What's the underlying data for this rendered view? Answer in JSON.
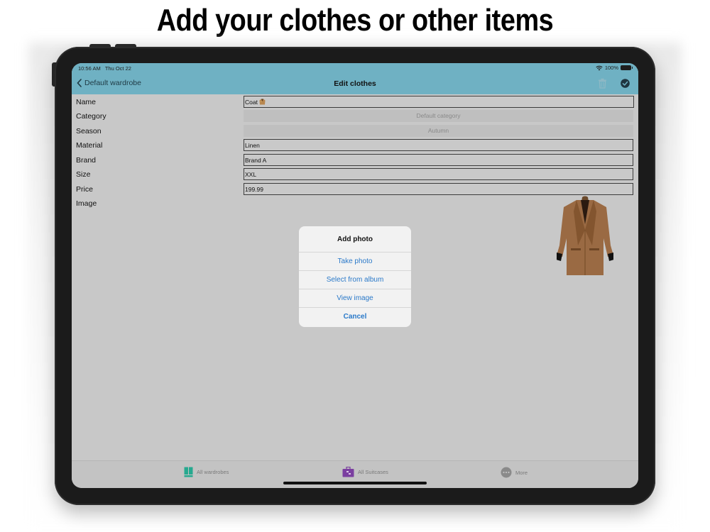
{
  "headline": "Add your clothes or other items",
  "status": {
    "time": "10:56 AM",
    "date": "Thu Oct 22",
    "battery": "100%"
  },
  "nav": {
    "back_label": "Default wardrobe",
    "title": "Edit clothes"
  },
  "form": {
    "name_label": "Name",
    "name_value": "Coat",
    "category_label": "Category",
    "category_value": "Default category",
    "season_label": "Season",
    "season_value": "Autumn",
    "material_label": "Material",
    "material_value": "Linen",
    "brand_label": "Brand",
    "brand_value": "Brand A",
    "size_label": "Size",
    "size_value": "XXL",
    "price_label": "Price",
    "price_value": "199.99",
    "image_label": "Image"
  },
  "sheet": {
    "title": "Add photo",
    "take_photo": "Take photo",
    "select_album": "Select from album",
    "view_image": "View image",
    "cancel": "Cancel"
  },
  "tabs": {
    "wardrobes": "All wardrobes",
    "suitcases": "All Suitcases",
    "more": "More"
  },
  "colors": {
    "nav_bg": "#6fb1c3",
    "action_blue": "#2a79c9",
    "wardrobe_icon": "#26a98f",
    "suitcase_icon": "#7b3fa0",
    "coat_brown": "#9a6a43"
  }
}
